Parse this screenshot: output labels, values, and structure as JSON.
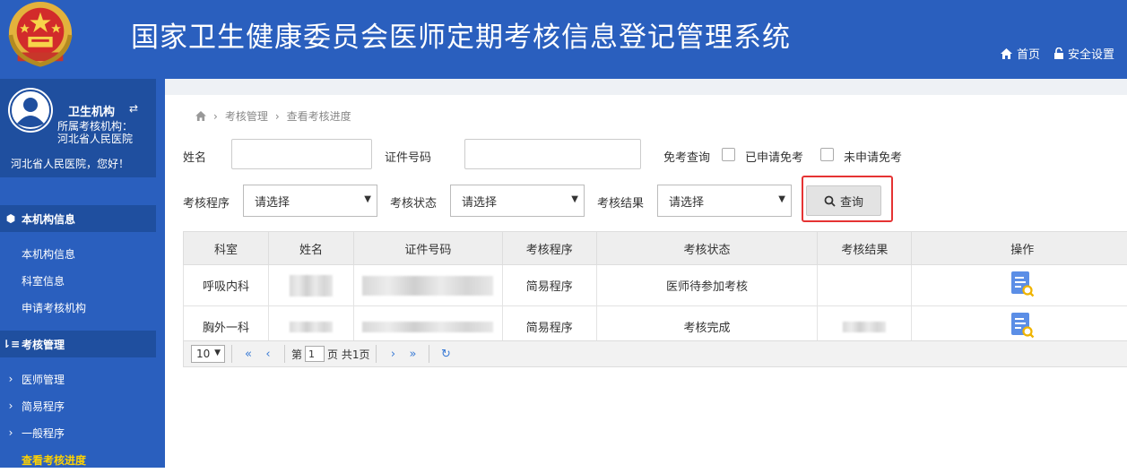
{
  "header": {
    "title": "国家卫生健康委员会医师定期考核信息登记管理系统",
    "home_label": "首页",
    "security_label": "安全设置"
  },
  "sidebar": {
    "user_name": "卫生机构",
    "org_label": "所属考核机构：",
    "org_name": "河北省人民医院",
    "greeting": "河北省人民医院，您好！",
    "sections": [
      {
        "title": "本机构信息",
        "icon": "cube-icon",
        "items": [
          "本机构信息",
          "科室信息",
          "申请考核机构"
        ]
      },
      {
        "title": "考核管理",
        "icon": "sort-icon",
        "items": [
          "医师管理",
          "简易程序",
          "一般程序",
          "查看考核进度"
        ]
      }
    ],
    "active_item": "查看考核进度"
  },
  "breadcrumb": [
    "考核管理",
    "查看考核进度"
  ],
  "filters": {
    "name_label": "姓名",
    "name_value": "",
    "id_label": "证件号码",
    "id_value": "",
    "exempt_label": "免考查询",
    "exempt_options": [
      "已申请免考",
      "未申请免考"
    ],
    "procedure_label": "考核程序",
    "procedure_value": "请选择",
    "status_label": "考核状态",
    "status_value": "请选择",
    "result_label": "考核结果",
    "result_value": "请选择",
    "search_button": "查询"
  },
  "table": {
    "columns": [
      "科室",
      "姓名",
      "证件号码",
      "考核程序",
      "考核状态",
      "考核结果",
      "操作"
    ],
    "rows": [
      {
        "dept": "呼吸内科",
        "procedure": "简易程序",
        "status": "医师待参加考核",
        "result": ""
      },
      {
        "dept": "胸外一科",
        "procedure": "简易程序",
        "status": "考核完成",
        "result": ""
      }
    ]
  },
  "pagination": {
    "page_size": "10",
    "page_prefix": "第",
    "current_page": "1",
    "page_suffix": "页 共1页"
  },
  "colors": {
    "header_bg": "#2a5fbe",
    "sidebar_section_bg": "#1f4f9f",
    "active_nav": "#ffd200",
    "highlight_border": "#e53333",
    "pager_link": "#3a7bd5"
  }
}
